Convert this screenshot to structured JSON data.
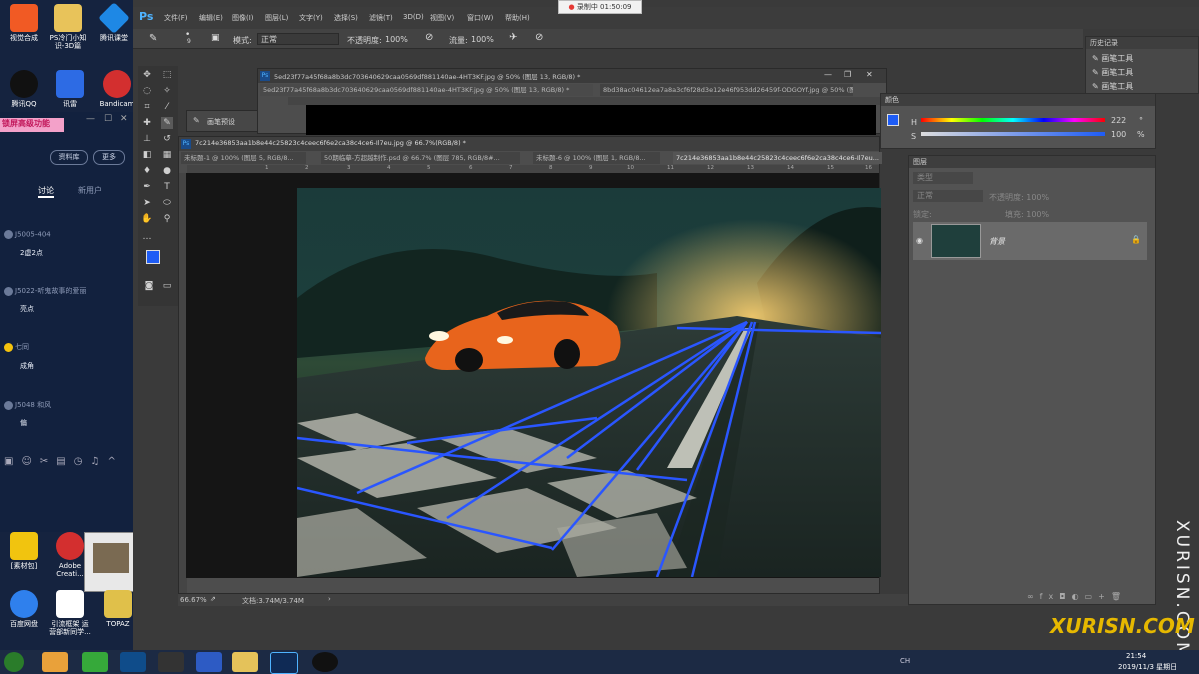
{
  "desktop_icons": [
    {
      "label": "视觉合成",
      "color": "#f15a24"
    },
    {
      "label": "PS冷门小知识-3D篇",
      "color": "#e8c35a"
    },
    {
      "label": "腾讯课堂",
      "color": "#1e88e5"
    },
    {
      "label": "腾讯QQ",
      "color": "#111111"
    },
    {
      "label": "讯雷",
      "color": "#2d6be4"
    },
    {
      "label": "Bandicam",
      "color": "#d32f2f"
    },
    {
      "label": "[素材包]",
      "color": "#f1c40f"
    },
    {
      "label": "Adobe Creati...",
      "color": "#d32f2f"
    },
    {
      "label": "百度网盘",
      "color": "#2f80ed"
    },
    {
      "label": "引流框架 运营部新同学...",
      "color": "#ffffff"
    },
    {
      "label": "TOPAZ",
      "color": "#e0c04a"
    }
  ],
  "chat": {
    "banner": "锁屏高级功能",
    "btn_library": "资料库",
    "btn_more": "更多",
    "tab_discuss": "讨论",
    "tab_new": "新用户",
    "messages": [
      {
        "user": "J5005-404",
        "text": "2虚2点"
      },
      {
        "user": "J5022-听鬼故事的爱丽",
        "text": "亮点"
      },
      {
        "user": "七同",
        "text": "成角"
      },
      {
        "user": "J5048 和风",
        "text": "偏"
      }
    ]
  },
  "recording": {
    "label": "录制中 01:50:09"
  },
  "ps": {
    "logo": "Ps",
    "menus": [
      "文件(F)",
      "编辑(E)",
      "图像(I)",
      "图层(L)",
      "文字(Y)",
      "选择(S)",
      "滤镜(T)",
      "3D(D)",
      "视图(V)",
      "窗口(W)",
      "帮助(H)"
    ],
    "options": {
      "mode_label": "模式:",
      "mode_value": "正常",
      "opacity_label": "不透明度:",
      "opacity_value": "100%",
      "flow_label": "流量:",
      "flow_value": "100%",
      "brush_size": "9"
    },
    "brush_preset_label": "画笔预设",
    "doc_back": {
      "title": "5ed23f77a45f68a8b3dc703640629caa0569df881140ae-4HT3KF.jpg @ 50% (图层 13, RGB/8) *",
      "tabs": [
        "5ed23f77a45f68a8b3dc703640629caa0569df881140ae-4HT3KF.jpg @ 50% (图层 13, RGB/8) *",
        "8bd38ac04612ea7a8a3cf6f28d3e12e46f953dd26459f-ODGOYf.jpg @ 50% (图层 1..."
      ]
    },
    "doc_front": {
      "title": "7c214e36853aa1b8e44c25823c4ceec6f6e2ca38c4ce6-Il7eu.jpg @ 66.7%(RGB/8) *",
      "tabs": [
        "未标题-1 @ 100% (图层 5, RGB/8...",
        "50期临摹-方超越制作.psd @ 66.7% (图层 785, RGB/8#...",
        "未标题-6 @ 100% (图层 1, RGB/8...",
        "7c214e36853aa1b8e44c25823c4ceec6f6e2ca38c4ce6-Il7eu..."
      ]
    },
    "ruler_ticks": [
      "1",
      "2",
      "3",
      "4",
      "5",
      "6",
      "7",
      "8",
      "9",
      "10",
      "11",
      "12",
      "13",
      "14",
      "15",
      "16"
    ],
    "status": {
      "zoom": "66.67%",
      "doc": "文档:3.74M/3.74M"
    },
    "history": {
      "title": "历史记录",
      "items": [
        "画笔工具",
        "画笔工具",
        "画笔工具"
      ]
    },
    "color": {
      "title": "颜色",
      "h_label": "H",
      "h_value": "222",
      "s_label": "S",
      "s_value": "100",
      "pct": "%",
      "deg": "°"
    },
    "layers": {
      "title": "图层",
      "kind": "类型",
      "blend": "正常",
      "opacity": "不透明度: 100%",
      "lock": "锁定:",
      "fill": "填充: 100%",
      "layer_name": "背景"
    },
    "watermark": "XURISN.COM"
  },
  "taskbar": {
    "time": "21:54",
    "date": "2019/11/3 星期日",
    "ch": "CH"
  },
  "colors": {
    "ps_blue": "#1e5cf5",
    "orange_car": "#e8641c",
    "guide_blue": "#2a56ff"
  }
}
